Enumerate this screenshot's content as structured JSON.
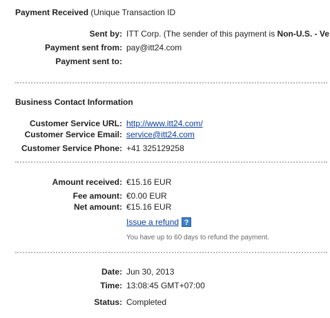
{
  "header": {
    "title_bold": "Payment Received",
    "title_rest": " (Unique Transaction ID"
  },
  "sender": {
    "sent_by_label": "Sent by:",
    "sent_by_value_1": "ITT Corp. (The sender of this payment is ",
    "sent_by_value_bold": "Non-U.S. - Ve",
    "sent_from_label": "Payment sent from:",
    "sent_from_value": "pay@itt24.com",
    "sent_to_label": "Payment sent to:",
    "sent_to_value": ""
  },
  "business": {
    "heading": "Business Contact Information",
    "url_label": "Customer Service URL:",
    "url_value": "http://www.itt24.com/",
    "email_label": "Customer Service Email:",
    "email_value": "service@itt24.com",
    "phone_label": "Customer Service Phone:",
    "phone_value": "+41 325129258"
  },
  "amounts": {
    "received_label": "Amount received:",
    "received_value": "€15.16 EUR",
    "fee_label": "Fee amount:",
    "fee_value": "€0.00 EUR",
    "net_label": "Net amount:",
    "net_value": "€15.16 EUR",
    "refund_link": "Issue a refund",
    "help_icon": "?",
    "refund_note": "You have up to 60 days to refund the payment."
  },
  "details": {
    "date_label": "Date:",
    "date_value": "Jun 30, 2013",
    "time_label": "Time:",
    "time_value": "13:08:45 GMT+07:00",
    "status_label": "Status:",
    "status_value": "Completed"
  },
  "colors": {
    "link": "#0b3f9c",
    "help_bg": "#3d7fc7",
    "separator": "#b8b8b8"
  }
}
